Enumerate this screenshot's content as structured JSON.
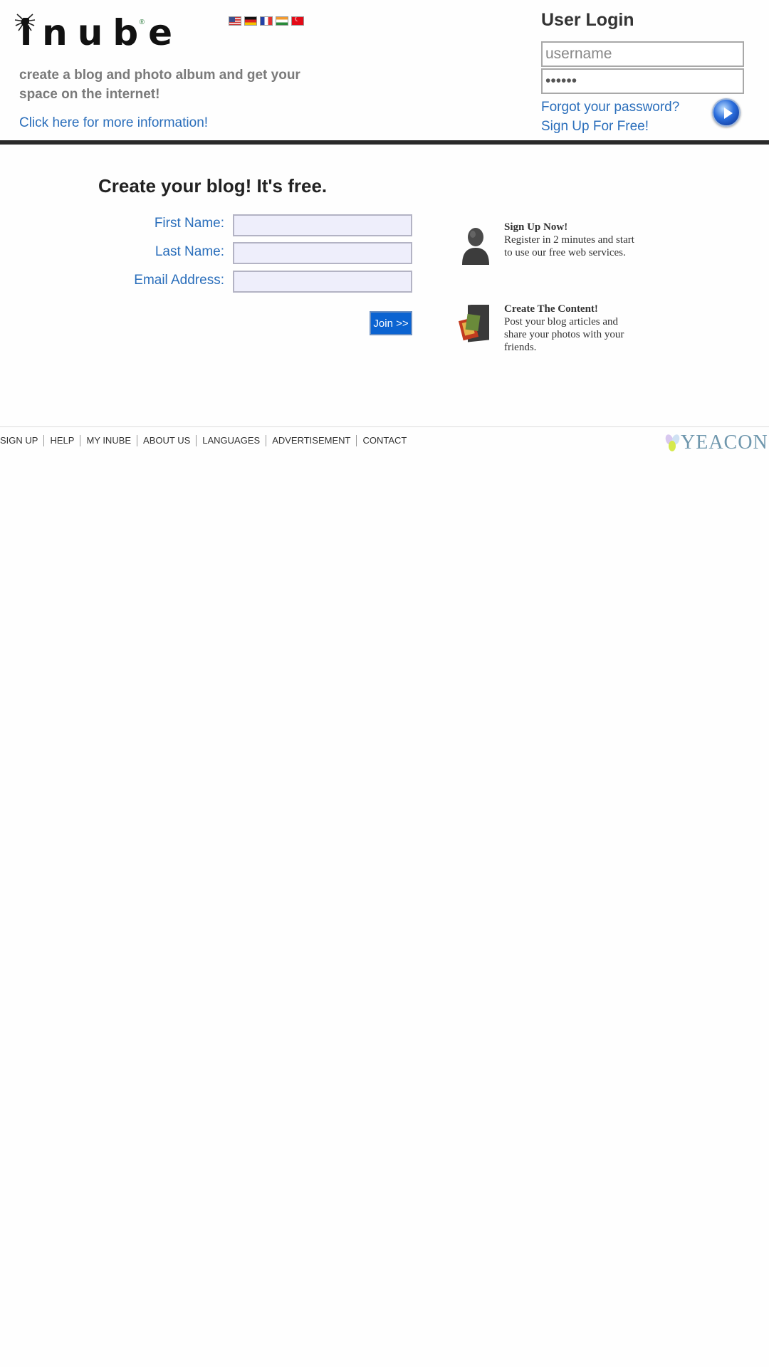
{
  "header": {
    "logo_text": "inube",
    "languages": [
      "English",
      "German",
      "French",
      "Hindi",
      "Turkish"
    ],
    "tagline": "create a blog and photo album and get your space on the internet!",
    "more_info_link": "Click here for more information!"
  },
  "login": {
    "title": "User Login",
    "username_placeholder": "username",
    "password_value": "••••••",
    "forgot_link": "Forgot your password?",
    "signup_link": "Sign Up For Free!",
    "submit_icon": "play-arrow-icon"
  },
  "signup_form": {
    "title": "Create your blog! It's free.",
    "first_name_label": "First Name:",
    "last_name_label": "Last Name:",
    "email_label": "Email Address:",
    "join_label": "Join >>"
  },
  "features": [
    {
      "icon": "user-silhouette-icon",
      "title": "Sign Up Now!",
      "text": "Register in 2 minutes and start to use our free web services."
    },
    {
      "icon": "photo-album-icon",
      "title": "Create The Content!",
      "text": "Post your blog articles and share your photos with your friends."
    }
  ],
  "footer": {
    "links": [
      "SIGN UP",
      "HELP",
      "MY INUBE",
      "ABOUT US",
      "LANGUAGES",
      "ADVERTISEMENT",
      "CONTACT"
    ],
    "partner_logo": "YEACON"
  },
  "colors": {
    "link_blue": "#2a6ebb",
    "join_button": "#0b63d1",
    "header_rule": "#2a2a2a",
    "input_fill": "#eeeefb"
  }
}
